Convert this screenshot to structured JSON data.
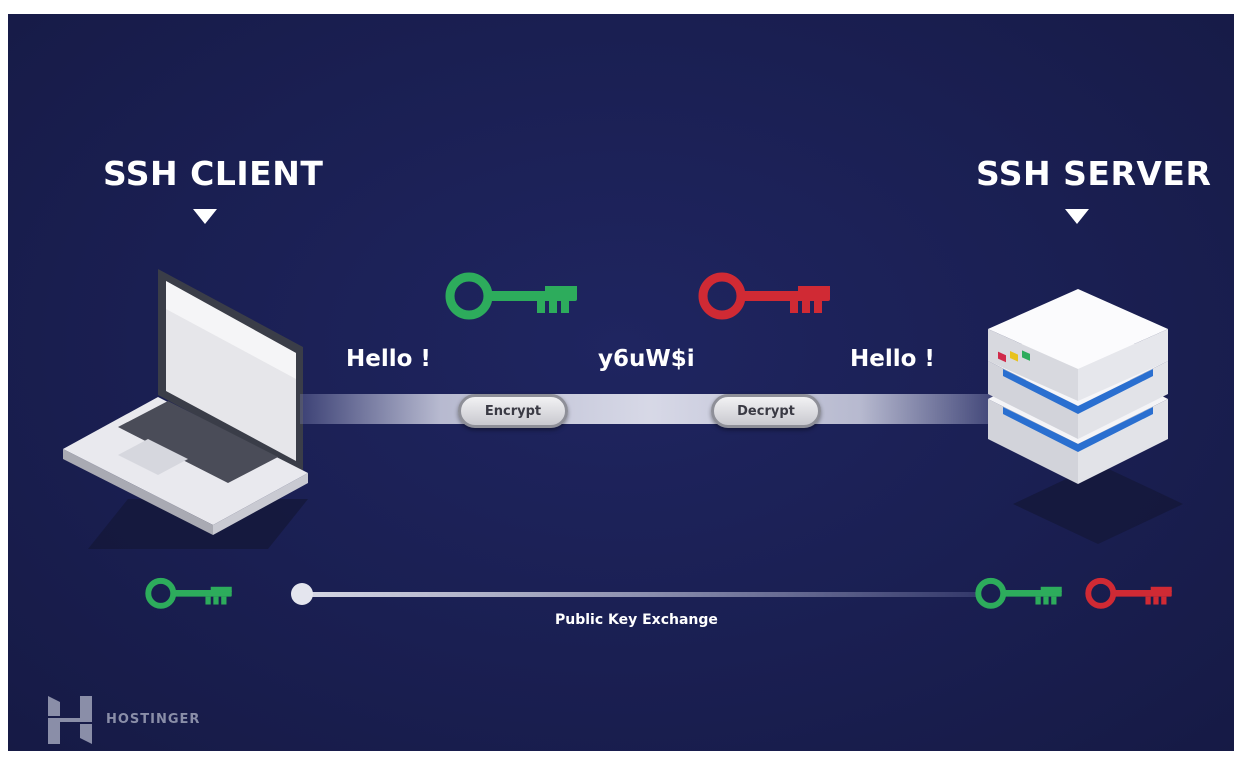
{
  "diagram": {
    "client_title": "SSH CLIENT",
    "server_title": "SSH SERVER",
    "client_message": "Hello !",
    "cipher_text": "y6uW$i",
    "server_message": "Hello !",
    "encrypt_label": "Encrypt",
    "decrypt_label": "Decrypt",
    "exchange_label": "Public Key Exchange"
  },
  "brand": {
    "name": "HOSTINGER"
  },
  "colors": {
    "background": "#1a1f52",
    "public_key": "#2dac5c",
    "private_key": "#d02a34",
    "text": "#ffffff"
  }
}
